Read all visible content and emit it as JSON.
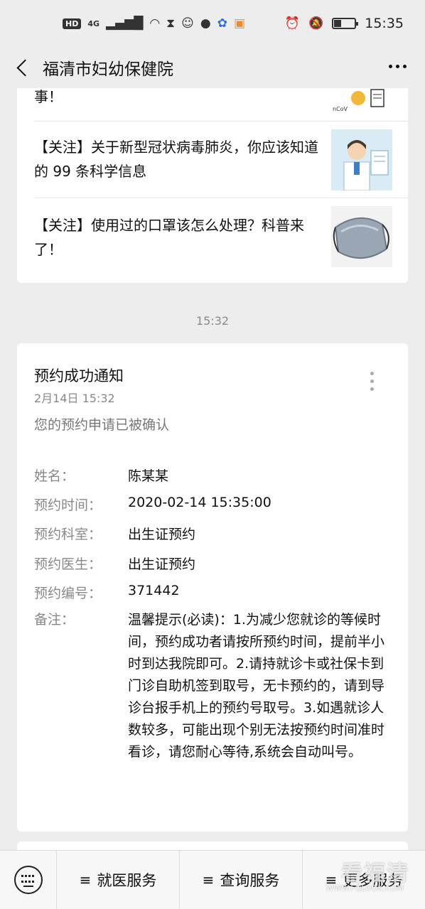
{
  "status_bar": {
    "hd_label": "HD",
    "network_label": "4G",
    "time": "15:35",
    "icons": [
      "signal-icon",
      "wifi-icon",
      "hourglass-icon",
      "qq-icon",
      "chat-icon",
      "baidu-icon",
      "uc-icon",
      "alarm-icon",
      "mute-icon",
      "battery-icon"
    ],
    "battery_level": 0.3
  },
  "nav": {
    "title": "福清市妇幼保健院"
  },
  "articles": {
    "tail_text": "事！",
    "items": [
      {
        "title": "【关注】关于新型冠状病毒肺炎，你应该知道的 99 条科学信息",
        "thumb": "doctor-illustration"
      },
      {
        "title": "【关注】使用过的口罩该怎么处理？科普来了！",
        "thumb": "face-mask-photo"
      }
    ]
  },
  "timestamp": "15:32",
  "notification": {
    "title": "预约成功通知",
    "date": "2月14日  15:32",
    "subtitle": "您的预约申请已被确认",
    "fields": [
      {
        "label": "姓名：",
        "value": "陈某某"
      },
      {
        "label": "预约时间：",
        "value": "2020-02-14 15:35:00"
      },
      {
        "label": "预约科室：",
        "value": "出生证预约"
      },
      {
        "label": "预约医生：",
        "value": "出生证预约"
      },
      {
        "label": "预约编号：",
        "value": "371442"
      }
    ],
    "note_label": "备注：",
    "note_value": "温馨提示(必读)：1.为减少您就诊的等候时间，预约成功者请按所预约时间，提前半小时到达我院即可。2.请持就诊卡或社保卡到门诊自助机签到取号，无卡预约的，请到导诊台报手机上的预约号取号。3.如遇就诊人数较多，可能出现个别无法按预约时间准时看诊，请您耐心等待,系统会自动叫号。"
  },
  "bottom_menu": {
    "items": [
      "就医服务",
      "查询服务",
      "更多服务"
    ]
  },
  "watermark": {
    "text": "看福清",
    "url": "WWW.FQLOOK.COM"
  }
}
